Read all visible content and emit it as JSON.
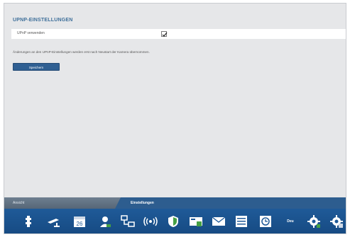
{
  "section": {
    "title": "UPNP-EINSTELLUNGEN"
  },
  "upnp": {
    "label": "UPnP verwenden",
    "checked": true
  },
  "info": {
    "text": "Änderungen an den UPnP-Einstellungen werden erst nach Neustart der Kamera übernommen."
  },
  "actions": {
    "apply_label": "Speichern"
  },
  "tabs": {
    "inactive_label": "Ansicht",
    "active_label": "Einstellungen"
  },
  "dock": {
    "items": [
      {
        "icon": "network-plug-icon"
      },
      {
        "icon": "camera-icon"
      },
      {
        "icon": "calendar-icon",
        "text": "26"
      },
      {
        "icon": "user-icon"
      },
      {
        "icon": "network-devices-icon"
      },
      {
        "icon": "wireless-icon"
      },
      {
        "icon": "shield-icon"
      },
      {
        "icon": "storage-icon"
      },
      {
        "icon": "mail-icon"
      },
      {
        "icon": "list-icon"
      },
      {
        "icon": "clock-icon"
      },
      {
        "icon": "language-icon",
        "text": "Deu"
      },
      {
        "icon": "gear-icon"
      },
      {
        "icon": "advanced-settings-icon"
      }
    ]
  },
  "colors": {
    "accent": "#2f5f92",
    "title": "#3e6f9a",
    "panel": "#e6e7e9",
    "dock": "#1f5a98"
  }
}
